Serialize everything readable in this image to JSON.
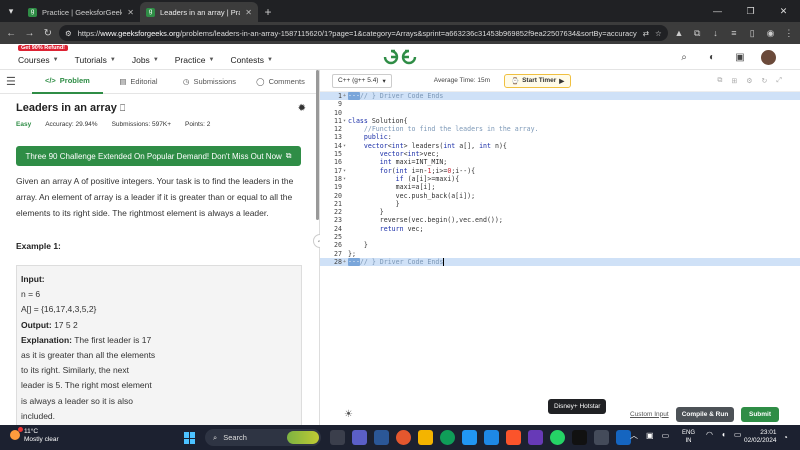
{
  "browser": {
    "tabs": [
      {
        "title": "Practice | GeeksforGeeks | A co",
        "active": false
      },
      {
        "title": "Leaders in an array | Practice | G",
        "active": true
      }
    ],
    "url_prefix": "https://",
    "url_host": "www.geeksforgeeks.org",
    "url_rest": "/problems/leaders-in-an-array-1587115620/1?page=1&category=Arrays&sprint=a663236c31453b969852f9ea22507634&sortBy=accuracy"
  },
  "site": {
    "promo_badge": "Get 90% Refund!",
    "nav": [
      "Courses",
      "Tutorials",
      "Jobs",
      "Practice",
      "Contests"
    ]
  },
  "left": {
    "tabs": [
      "Problem",
      "Editorial",
      "Submissions",
      "Comments"
    ],
    "title": "Leaders in an array",
    "difficulty": "Easy",
    "accuracy": "Accuracy: 29.94%",
    "submissions": "Submissions: 597K+",
    "points": "Points: 2",
    "banner": "Three 90 Challenge Extended On Popular Demand! Don't Miss Out Now",
    "description": "Given an array A of positive integers. Your task is to find the leaders in the array. An element of array is a leader if it is greater than or equal to all the elements to its right side. The rightmost element is always a leader.",
    "example_heading": "Example 1:",
    "example": {
      "input_label": "Input:",
      "n_line": "n = 6",
      "array_line": "A[] = {16,17,4,3,5,2}",
      "output_label": "Output:",
      "output_value": "17  5  2",
      "explanation_label": "Explanation:",
      "explanation_lines": [
        "The first leader is 17",
        "as it is greater than all the elements",
        "to its right.   Similarly, the next",
        "leader is 5. The right most element",
        "is always a leader so it is also",
        "included."
      ]
    }
  },
  "editor": {
    "language": "C++ (g++ 5.4)",
    "avg_time": "Average Time: 15m",
    "timer": "Start Timer",
    "footer": {
      "tooltip": "Disney+ Hotstar",
      "custom_input": "Custom Input",
      "compile": "Compile & Run",
      "submit": "Submit"
    }
  },
  "taskbar": {
    "temp": "11°C",
    "weather": "Mostly clear",
    "search": "Search",
    "lang_top": "ENG",
    "lang_bottom": "IN",
    "time": "23:01",
    "date": "02/02/2024"
  }
}
